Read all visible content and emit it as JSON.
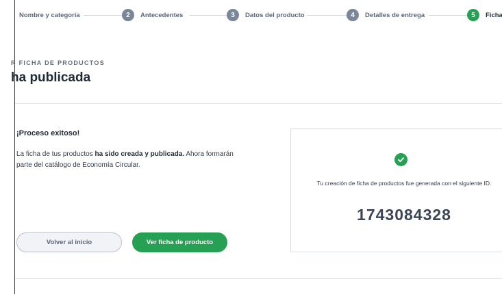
{
  "stepper": {
    "steps": [
      {
        "number": "",
        "label": "Nombre y categoría"
      },
      {
        "number": "2",
        "label": "Antecedentes"
      },
      {
        "number": "3",
        "label": "Datos del producto"
      },
      {
        "number": "4",
        "label": "Detalles de entrega"
      },
      {
        "number": "5",
        "label": "Ficha"
      }
    ],
    "colors": {
      "active": "#26a154",
      "inactive": "#7a8699"
    }
  },
  "header": {
    "breadcrumb": "R FICHA DE PRODUCTOS",
    "title": "ha publicada"
  },
  "content": {
    "success_title": "¡Proceso exitoso!",
    "message_before": "La ficha de tus productos ",
    "message_bold": "ha sido creada y publicada.",
    "message_after": " Ahora formarán parte del catálogo de Economía Circular.",
    "back_button": "Volver al inicio",
    "view_button": "Ver ficha de producto"
  },
  "id_card": {
    "icon": "check-circle-icon",
    "caption": "Tu creación de ficha de productos fue generada con el siguiente ID.",
    "id_value": "1743084328"
  }
}
